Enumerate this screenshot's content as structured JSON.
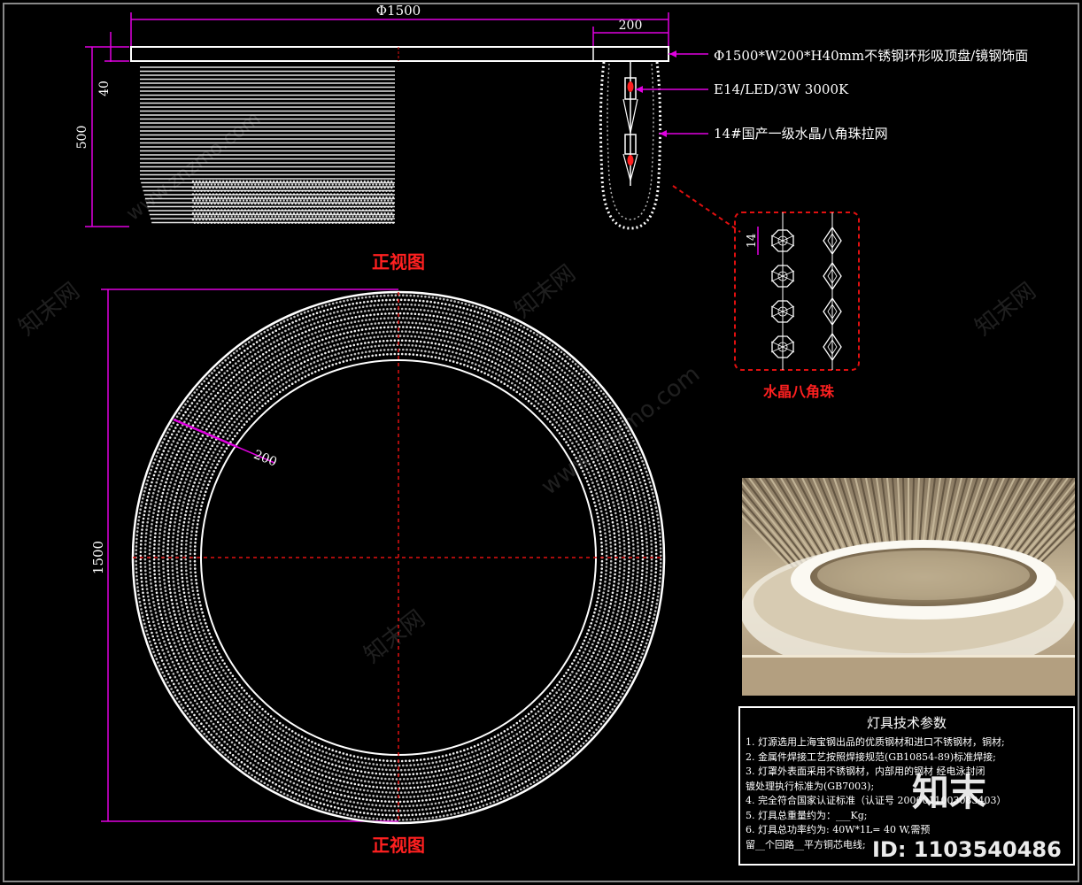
{
  "dimensions": {
    "top_diameter": "Φ1500",
    "width_200": "200",
    "height_40": "40",
    "height_500": "500",
    "bead_14": "14",
    "ring_width_200": "200",
    "diameter_1500": "1500"
  },
  "callouts": {
    "canopy": "Φ1500*W200*H40mm不锈钢环形吸顶盘/镜钢饰面",
    "lamp": "E14/LED/3W 3000K",
    "crystal_net": "14#国产一级水晶八角珠拉网"
  },
  "titles": {
    "front_view_top": "正视图",
    "front_view_bottom": "正视图",
    "crystal_detail": "水晶八角珠"
  },
  "spec_table": {
    "title": "灯具技术参数",
    "lines": [
      "1. 灯源选用上海宝钢出品的优质钢材和进口不锈钢材，铜材;",
      "2. 金属件焊接工艺按照焊接规范(GB10854-89)标准焊接;",
      "3. 灯罩外表面采用不锈钢材，内部用的钢材 经电泳封闭",
      "   镀处理执行标准为(GB7003);",
      "4. 完全符合国家认证标准（认证号 2006011003083403）",
      "5. 灯具总重量约为：___Kg;",
      "6. 灯具总功率约为: 40W*1L= 40 W,需预",
      "   留__个回路__平方铜芯电线;"
    ]
  },
  "watermark": {
    "brand": "知末",
    "id": "ID: 1103540486",
    "site": "www.znzmo.com",
    "cn_site": "知末网"
  },
  "colors": {
    "dimension_line": "#e000e0",
    "center_line": "#e01010",
    "title_red": "#ff2020",
    "detail_box": "#e01010"
  }
}
